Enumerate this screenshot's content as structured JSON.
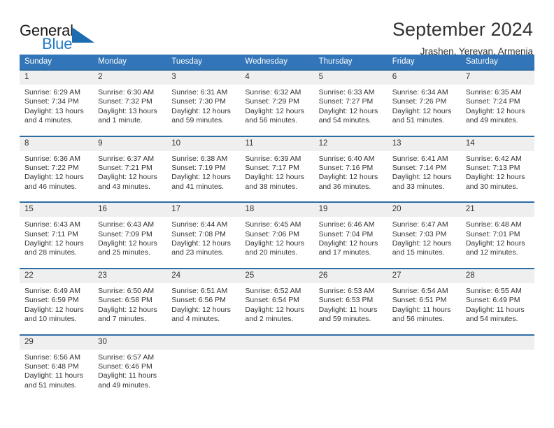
{
  "brand": {
    "name_top": "General",
    "name_bottom": "Blue",
    "triangle_color": "#1b6cb0",
    "blue_text_color": "#1d7ac4"
  },
  "header": {
    "title": "September 2024",
    "subtitle": "Jrashen, Yerevan, Armenia"
  },
  "theme": {
    "header_row_bg": "#3275b9",
    "cell_border": "#2e6da4",
    "daynum_bg": "#efefef",
    "text": "#333333"
  },
  "columns": [
    "Sunday",
    "Monday",
    "Tuesday",
    "Wednesday",
    "Thursday",
    "Friday",
    "Saturday"
  ],
  "weeks": [
    [
      {
        "day": "1",
        "sunrise": "Sunrise: 6:29 AM",
        "sunset": "Sunset: 7:34 PM",
        "daylight1": "Daylight: 13 hours",
        "daylight2": "and 4 minutes."
      },
      {
        "day": "2",
        "sunrise": "Sunrise: 6:30 AM",
        "sunset": "Sunset: 7:32 PM",
        "daylight1": "Daylight: 13 hours",
        "daylight2": "and 1 minute."
      },
      {
        "day": "3",
        "sunrise": "Sunrise: 6:31 AM",
        "sunset": "Sunset: 7:30 PM",
        "daylight1": "Daylight: 12 hours",
        "daylight2": "and 59 minutes."
      },
      {
        "day": "4",
        "sunrise": "Sunrise: 6:32 AM",
        "sunset": "Sunset: 7:29 PM",
        "daylight1": "Daylight: 12 hours",
        "daylight2": "and 56 minutes."
      },
      {
        "day": "5",
        "sunrise": "Sunrise: 6:33 AM",
        "sunset": "Sunset: 7:27 PM",
        "daylight1": "Daylight: 12 hours",
        "daylight2": "and 54 minutes."
      },
      {
        "day": "6",
        "sunrise": "Sunrise: 6:34 AM",
        "sunset": "Sunset: 7:26 PM",
        "daylight1": "Daylight: 12 hours",
        "daylight2": "and 51 minutes."
      },
      {
        "day": "7",
        "sunrise": "Sunrise: 6:35 AM",
        "sunset": "Sunset: 7:24 PM",
        "daylight1": "Daylight: 12 hours",
        "daylight2": "and 49 minutes."
      }
    ],
    [
      {
        "day": "8",
        "sunrise": "Sunrise: 6:36 AM",
        "sunset": "Sunset: 7:22 PM",
        "daylight1": "Daylight: 12 hours",
        "daylight2": "and 46 minutes."
      },
      {
        "day": "9",
        "sunrise": "Sunrise: 6:37 AM",
        "sunset": "Sunset: 7:21 PM",
        "daylight1": "Daylight: 12 hours",
        "daylight2": "and 43 minutes."
      },
      {
        "day": "10",
        "sunrise": "Sunrise: 6:38 AM",
        "sunset": "Sunset: 7:19 PM",
        "daylight1": "Daylight: 12 hours",
        "daylight2": "and 41 minutes."
      },
      {
        "day": "11",
        "sunrise": "Sunrise: 6:39 AM",
        "sunset": "Sunset: 7:17 PM",
        "daylight1": "Daylight: 12 hours",
        "daylight2": "and 38 minutes."
      },
      {
        "day": "12",
        "sunrise": "Sunrise: 6:40 AM",
        "sunset": "Sunset: 7:16 PM",
        "daylight1": "Daylight: 12 hours",
        "daylight2": "and 36 minutes."
      },
      {
        "day": "13",
        "sunrise": "Sunrise: 6:41 AM",
        "sunset": "Sunset: 7:14 PM",
        "daylight1": "Daylight: 12 hours",
        "daylight2": "and 33 minutes."
      },
      {
        "day": "14",
        "sunrise": "Sunrise: 6:42 AM",
        "sunset": "Sunset: 7:13 PM",
        "daylight1": "Daylight: 12 hours",
        "daylight2": "and 30 minutes."
      }
    ],
    [
      {
        "day": "15",
        "sunrise": "Sunrise: 6:43 AM",
        "sunset": "Sunset: 7:11 PM",
        "daylight1": "Daylight: 12 hours",
        "daylight2": "and 28 minutes."
      },
      {
        "day": "16",
        "sunrise": "Sunrise: 6:43 AM",
        "sunset": "Sunset: 7:09 PM",
        "daylight1": "Daylight: 12 hours",
        "daylight2": "and 25 minutes."
      },
      {
        "day": "17",
        "sunrise": "Sunrise: 6:44 AM",
        "sunset": "Sunset: 7:08 PM",
        "daylight1": "Daylight: 12 hours",
        "daylight2": "and 23 minutes."
      },
      {
        "day": "18",
        "sunrise": "Sunrise: 6:45 AM",
        "sunset": "Sunset: 7:06 PM",
        "daylight1": "Daylight: 12 hours",
        "daylight2": "and 20 minutes."
      },
      {
        "day": "19",
        "sunrise": "Sunrise: 6:46 AM",
        "sunset": "Sunset: 7:04 PM",
        "daylight1": "Daylight: 12 hours",
        "daylight2": "and 17 minutes."
      },
      {
        "day": "20",
        "sunrise": "Sunrise: 6:47 AM",
        "sunset": "Sunset: 7:03 PM",
        "daylight1": "Daylight: 12 hours",
        "daylight2": "and 15 minutes."
      },
      {
        "day": "21",
        "sunrise": "Sunrise: 6:48 AM",
        "sunset": "Sunset: 7:01 PM",
        "daylight1": "Daylight: 12 hours",
        "daylight2": "and 12 minutes."
      }
    ],
    [
      {
        "day": "22",
        "sunrise": "Sunrise: 6:49 AM",
        "sunset": "Sunset: 6:59 PM",
        "daylight1": "Daylight: 12 hours",
        "daylight2": "and 10 minutes."
      },
      {
        "day": "23",
        "sunrise": "Sunrise: 6:50 AM",
        "sunset": "Sunset: 6:58 PM",
        "daylight1": "Daylight: 12 hours",
        "daylight2": "and 7 minutes."
      },
      {
        "day": "24",
        "sunrise": "Sunrise: 6:51 AM",
        "sunset": "Sunset: 6:56 PM",
        "daylight1": "Daylight: 12 hours",
        "daylight2": "and 4 minutes."
      },
      {
        "day": "25",
        "sunrise": "Sunrise: 6:52 AM",
        "sunset": "Sunset: 6:54 PM",
        "daylight1": "Daylight: 12 hours",
        "daylight2": "and 2 minutes."
      },
      {
        "day": "26",
        "sunrise": "Sunrise: 6:53 AM",
        "sunset": "Sunset: 6:53 PM",
        "daylight1": "Daylight: 11 hours",
        "daylight2": "and 59 minutes."
      },
      {
        "day": "27",
        "sunrise": "Sunrise: 6:54 AM",
        "sunset": "Sunset: 6:51 PM",
        "daylight1": "Daylight: 11 hours",
        "daylight2": "and 56 minutes."
      },
      {
        "day": "28",
        "sunrise": "Sunrise: 6:55 AM",
        "sunset": "Sunset: 6:49 PM",
        "daylight1": "Daylight: 11 hours",
        "daylight2": "and 54 minutes."
      }
    ],
    [
      {
        "day": "29",
        "sunrise": "Sunrise: 6:56 AM",
        "sunset": "Sunset: 6:48 PM",
        "daylight1": "Daylight: 11 hours",
        "daylight2": "and 51 minutes."
      },
      {
        "day": "30",
        "sunrise": "Sunrise: 6:57 AM",
        "sunset": "Sunset: 6:46 PM",
        "daylight1": "Daylight: 11 hours",
        "daylight2": "and 49 minutes."
      },
      {
        "day": "",
        "sunrise": "",
        "sunset": "",
        "daylight1": "",
        "daylight2": ""
      },
      {
        "day": "",
        "sunrise": "",
        "sunset": "",
        "daylight1": "",
        "daylight2": ""
      },
      {
        "day": "",
        "sunrise": "",
        "sunset": "",
        "daylight1": "",
        "daylight2": ""
      },
      {
        "day": "",
        "sunrise": "",
        "sunset": "",
        "daylight1": "",
        "daylight2": ""
      },
      {
        "day": "",
        "sunrise": "",
        "sunset": "",
        "daylight1": "",
        "daylight2": ""
      }
    ]
  ]
}
